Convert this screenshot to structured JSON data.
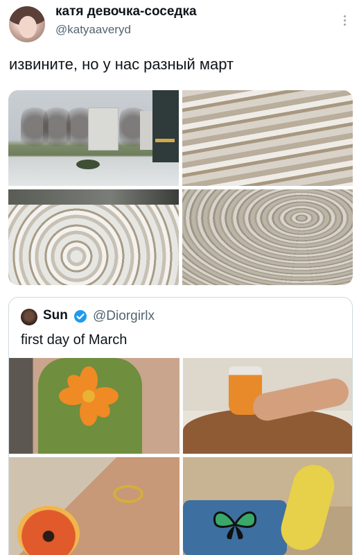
{
  "author": {
    "display_name": "катя девочка-соседка",
    "handle": "@katyaaveryd"
  },
  "tweet": {
    "text": "извините, но у нас разный март"
  },
  "media": [
    {
      "icon": "photo-city-snow"
    },
    {
      "icon": "photo-slush-road"
    },
    {
      "icon": "photo-melting-snow"
    },
    {
      "icon": "photo-icy-ground"
    }
  ],
  "quoted_tweet": {
    "display_name": "Sun",
    "handle": "@Diorgirlx",
    "text": "first day of March",
    "verified": true,
    "media": [
      {
        "icon": "photo-flower-top"
      },
      {
        "icon": "photo-orange-juice"
      },
      {
        "icon": "photo-papaya-gold-jewelry"
      },
      {
        "icon": "photo-butterfly-yellow-shoe"
      }
    ]
  },
  "colors": {
    "text_primary": "#0f1419",
    "text_secondary": "#536471",
    "verified_blue": "#1d9bf0",
    "border": "#cfd9de"
  }
}
